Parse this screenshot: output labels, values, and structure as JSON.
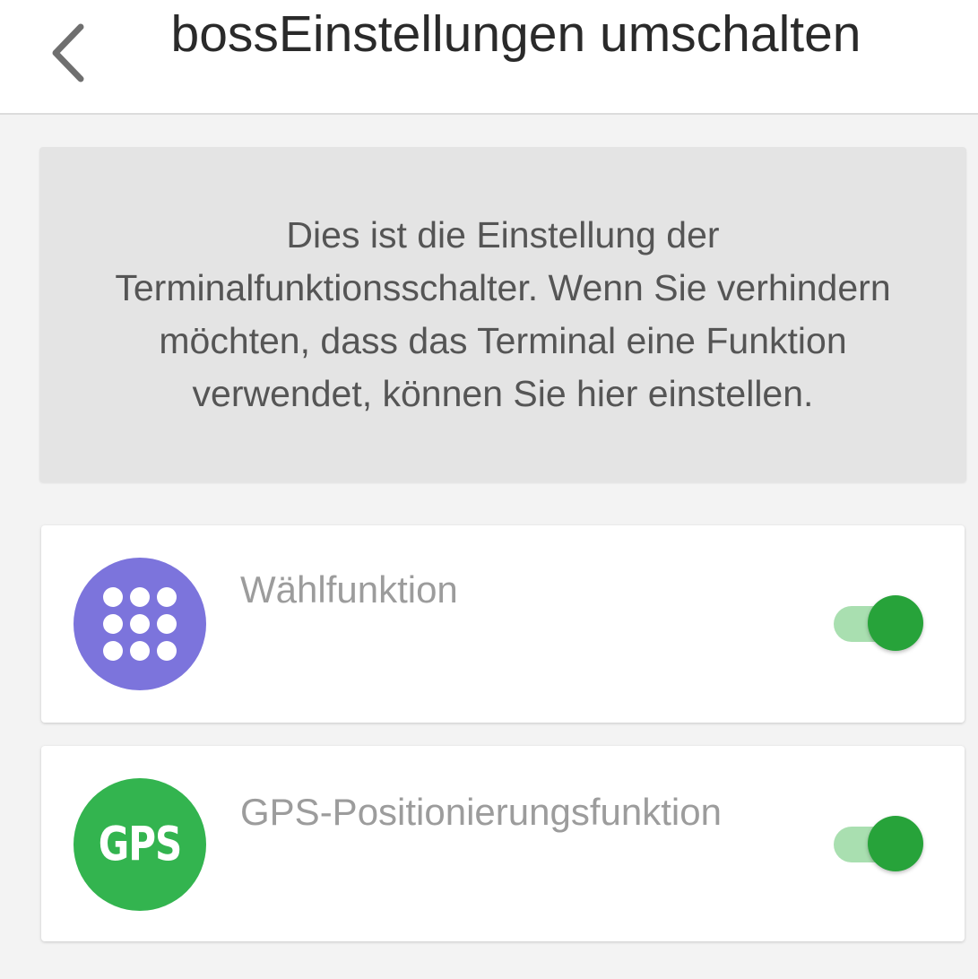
{
  "header": {
    "title": "bossEinstellungen umschalten",
    "back_icon": "chevron-left-icon"
  },
  "info": {
    "text": "Dies ist die Einstellung der Terminalfunktionsschalter. Wenn Sie verhindern möchten, dass das Terminal eine Funktion verwendet, können Sie hier einstellen."
  },
  "settings": [
    {
      "label": "Wählfunktion",
      "icon": "dialpad-icon",
      "icon_color": "#7c74dc",
      "enabled": true
    },
    {
      "label": "GPS-Positionierungsfunktion",
      "icon": "gps-icon",
      "icon_text": "GPS",
      "icon_color": "#33b44f",
      "enabled": true
    }
  ],
  "colors": {
    "toggle_on_thumb": "#27a33a",
    "toggle_on_track": "#a9dfb0",
    "label": "#9c9c9c"
  }
}
